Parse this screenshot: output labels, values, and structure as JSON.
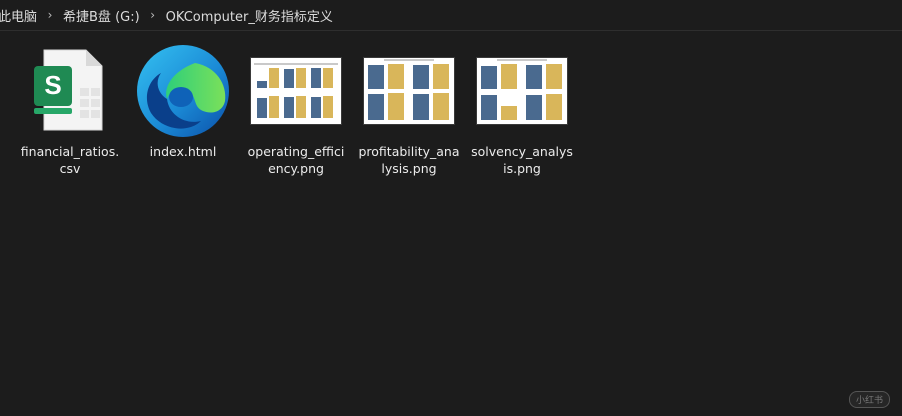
{
  "breadcrumb": {
    "items": [
      "此电脑",
      "希捷B盘 (G:)",
      "OKComputer_财务指标定义"
    ],
    "separator": "›"
  },
  "files": [
    {
      "name": "financial_ratios.csv",
      "icon": "csv-spreadsheet-icon"
    },
    {
      "name": "index.html",
      "icon": "edge-browser-icon"
    },
    {
      "name": "operating_efficiency.png",
      "icon": "image-thumbnail"
    },
    {
      "name": "profitability_analysis.png",
      "icon": "image-thumbnail"
    },
    {
      "name": "solvency_analysis.png",
      "icon": "image-thumbnail"
    }
  ],
  "colors": {
    "background": "#1c1c1c",
    "bar_blue": "#4a6a8f",
    "bar_yellow": "#d9b65a",
    "csv_green": "#1f8a53"
  },
  "watermark": "小红书"
}
